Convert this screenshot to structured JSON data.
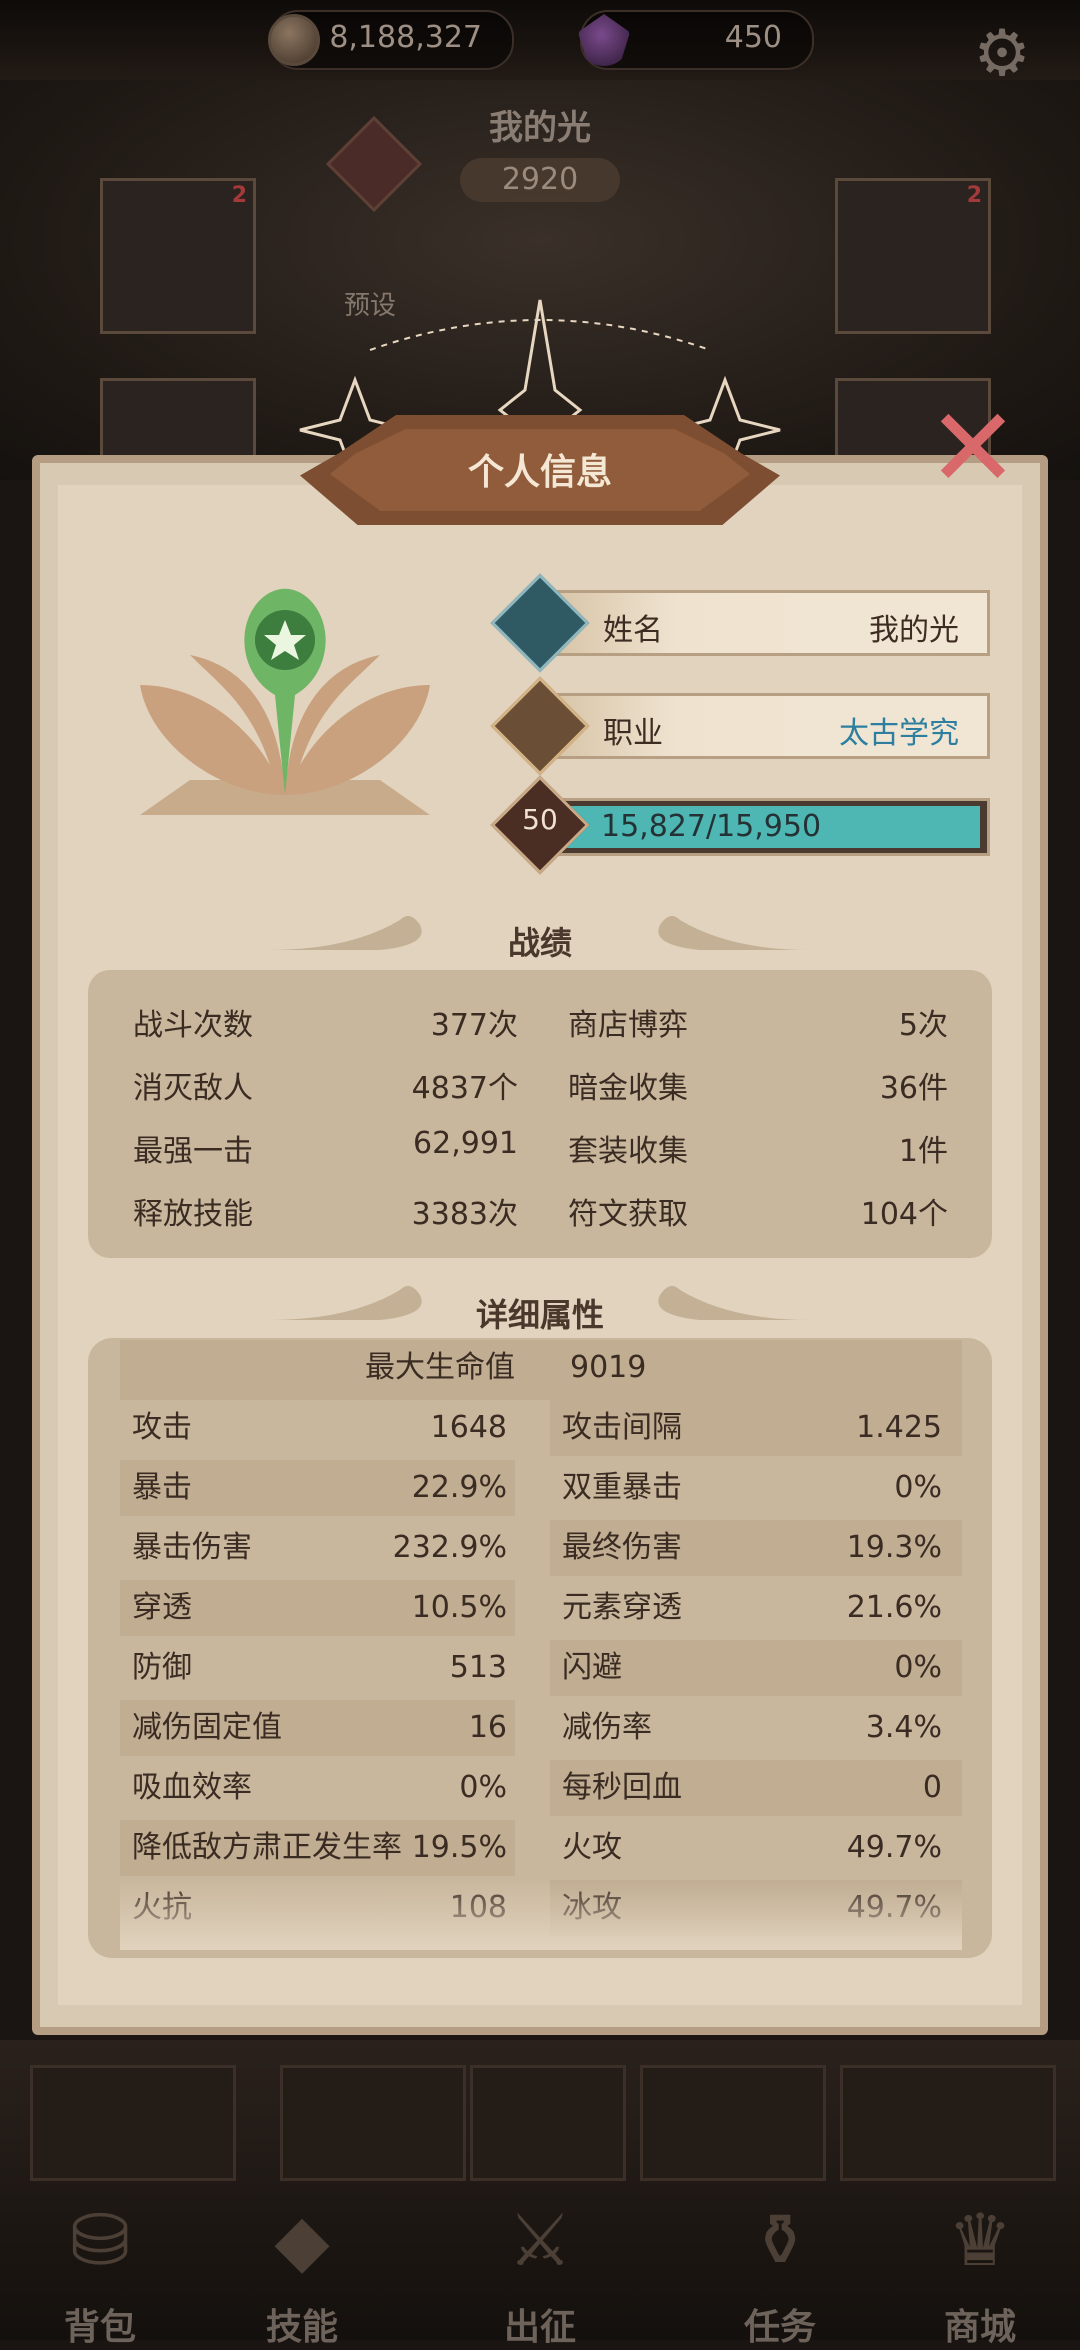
{
  "topbar": {
    "coins": "8,188,327",
    "gems": "450"
  },
  "hero": {
    "name": "我的光",
    "power": "2920",
    "slot_badge_left": "2",
    "slot_badge_right": "2",
    "preset_label": "预设"
  },
  "panel": {
    "title": "个人信息",
    "name_label": "姓名",
    "name_value": "我的光",
    "class_label": "职业",
    "class_value": "太古学究",
    "level": "50",
    "xp_text": "15,827/15,950",
    "xp_fraction": 0.992
  },
  "records": {
    "title": "战绩",
    "items": [
      {
        "label": "战斗次数",
        "value": "377次"
      },
      {
        "label": "商店博弈",
        "value": "5次"
      },
      {
        "label": "消灭敌人",
        "value": "4837个"
      },
      {
        "label": "暗金收集",
        "value": "36件"
      },
      {
        "label": "最强一击",
        "value": "62,991"
      },
      {
        "label": "套装收集",
        "value": "1件"
      },
      {
        "label": "释放技能",
        "value": "3383次"
      },
      {
        "label": "符文获取",
        "value": "104个"
      }
    ]
  },
  "attributes": {
    "title": "详细属性",
    "max_hp_label": "最大生命值",
    "max_hp_value": "9019",
    "rows": [
      {
        "l_label": "攻击",
        "l_value": "1648",
        "r_label": "攻击间隔",
        "r_value": "1.425"
      },
      {
        "l_label": "暴击",
        "l_value": "22.9%",
        "r_label": "双重暴击",
        "r_value": "0%"
      },
      {
        "l_label": "暴击伤害",
        "l_value": "232.9%",
        "r_label": "最终伤害",
        "r_value": "19.3%"
      },
      {
        "l_label": "穿透",
        "l_value": "10.5%",
        "r_label": "元素穿透",
        "r_value": "21.6%"
      },
      {
        "l_label": "防御",
        "l_value": "513",
        "r_label": "闪避",
        "r_value": "0%"
      },
      {
        "l_label": "减伤固定值",
        "l_value": "16",
        "r_label": "减伤率",
        "r_value": "3.4%"
      },
      {
        "l_label": "吸血效率",
        "l_value": "0%",
        "r_label": "每秒回血",
        "r_value": "0"
      },
      {
        "l_label": "降低敌方肃正发生率",
        "l_value": "19.5%",
        "r_label": "火攻",
        "r_value": "49.7%"
      },
      {
        "l_label": "火抗",
        "l_value": "108",
        "r_label": "冰攻",
        "r_value": "49.7%"
      }
    ]
  },
  "nav": {
    "items": [
      {
        "label": "背包",
        "icon": "bag-icon"
      },
      {
        "label": "技能",
        "icon": "skill-book-icon"
      },
      {
        "label": "出征",
        "icon": "sword-map-icon"
      },
      {
        "label": "任务",
        "icon": "scroll-icon"
      },
      {
        "label": "商城",
        "icon": "shop-crown-icon"
      }
    ]
  },
  "colors": {
    "panel_bg": "#e1d3be",
    "title_plate": "#7d4e32",
    "xp_fill": "#4fb7b3",
    "class_value": "#2e7f9f",
    "close_x": "#d9686a"
  }
}
